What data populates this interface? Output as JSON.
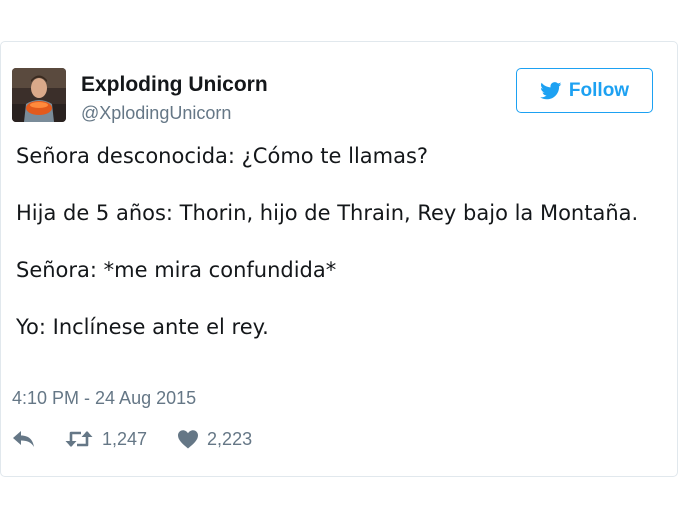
{
  "tweet": {
    "author": {
      "display_name": "Exploding Unicorn",
      "handle": "@XplodingUnicorn",
      "avatar_icon": "profile-photo"
    },
    "follow_button": {
      "label": "Follow",
      "icon": "twitter-bird-icon",
      "color": "#1da1f2"
    },
    "text_lines": [
      "Señora desconocida: ¿Cómo te llamas?",
      "Hija de 5 años: Thorin, hijo de Thrain, Rey bajo la Montaña.",
      "Señora: *me mira confundida*",
      "Yo: Inclínese ante el rey."
    ],
    "timestamp": "4:10 PM - 24 Aug 2015",
    "actions": {
      "reply": {
        "icon": "reply-icon"
      },
      "retweet": {
        "icon": "retweet-icon",
        "count": "1,247"
      },
      "like": {
        "icon": "heart-icon",
        "count": "2,223"
      }
    }
  }
}
